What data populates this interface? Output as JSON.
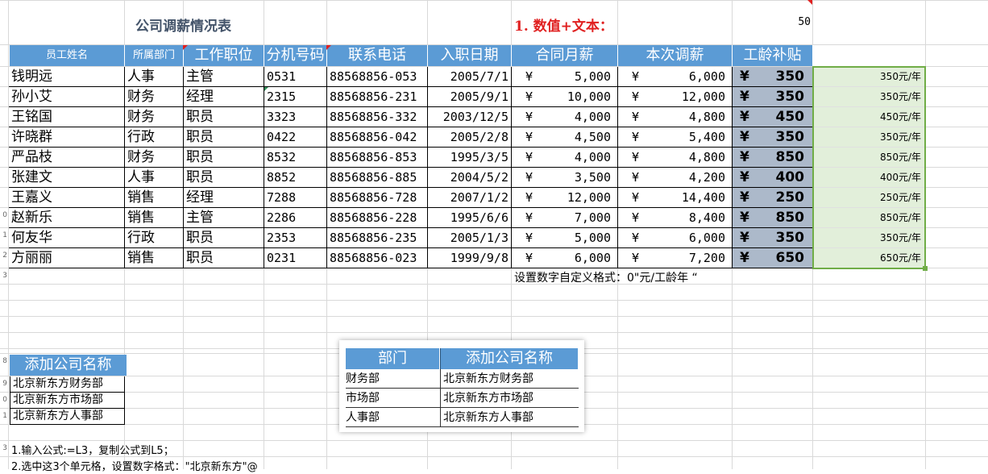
{
  "title": "公司调薪情况表",
  "example_label": "1. 数值+文本：",
  "example_value": "50",
  "headers": [
    "员工姓名",
    "所属部门",
    "工作职位",
    "分机号码",
    "联系电话",
    "入职日期",
    "合同月薪",
    "本次调薪",
    "工龄补贴"
  ],
  "rows": [
    {
      "name": "钱明远",
      "dept": "人事",
      "pos": "主管",
      "ext": "0531",
      "phone": "88568856-053",
      "date": "2005/7/1",
      "salary": "5,000",
      "raise": "6,000",
      "bonus": "350",
      "fmt": "350元/年"
    },
    {
      "name": "孙小艾",
      "dept": "财务",
      "pos": "经理",
      "ext": "2315",
      "phone": "88568856-231",
      "date": "2005/9/1",
      "salary": "10,000",
      "raise": "12,000",
      "bonus": "350",
      "fmt": "350元/年"
    },
    {
      "name": "王铭国",
      "dept": "财务",
      "pos": "职员",
      "ext": "3323",
      "phone": "88568856-332",
      "date": "2003/12/5",
      "salary": "4,000",
      "raise": "4,800",
      "bonus": "450",
      "fmt": "450元/年"
    },
    {
      "name": "许晓群",
      "dept": "行政",
      "pos": "职员",
      "ext": "0422",
      "phone": "88568856-042",
      "date": "2005/2/8",
      "salary": "4,500",
      "raise": "5,400",
      "bonus": "350",
      "fmt": "350元/年"
    },
    {
      "name": "严品枝",
      "dept": "财务",
      "pos": "职员",
      "ext": "8532",
      "phone": "88568856-853",
      "date": "1995/3/5",
      "salary": "4,000",
      "raise": "4,800",
      "bonus": "850",
      "fmt": "850元/年"
    },
    {
      "name": "张建文",
      "dept": "人事",
      "pos": "职员",
      "ext": "8852",
      "phone": "88568856-885",
      "date": "2004/5/2",
      "salary": "3,500",
      "raise": "4,200",
      "bonus": "400",
      "fmt": "400元/年"
    },
    {
      "name": "王嘉义",
      "dept": "销售",
      "pos": "经理",
      "ext": "7288",
      "phone": "88568856-728",
      "date": "2007/1/2",
      "salary": "12,000",
      "raise": "14,400",
      "bonus": "250",
      "fmt": "250元/年"
    },
    {
      "name": "赵新乐",
      "dept": "销售",
      "pos": "主管",
      "ext": "2286",
      "phone": "88568856-228",
      "date": "1995/6/6",
      "salary": "7,000",
      "raise": "8,400",
      "bonus": "850",
      "fmt": "850元/年"
    },
    {
      "name": "何友华",
      "dept": "行政",
      "pos": "职员",
      "ext": "2353",
      "phone": "88568856-235",
      "date": "2005/1/3",
      "salary": "5,000",
      "raise": "6,000",
      "bonus": "350",
      "fmt": "350元/年"
    },
    {
      "name": "方丽丽",
      "dept": "销售",
      "pos": "职员",
      "ext": "0231",
      "phone": "88568856-023",
      "date": "1999/9/8",
      "salary": "6,000",
      "raise": "7,200",
      "bonus": "650",
      "fmt": "650元/年"
    }
  ],
  "currency": "¥",
  "format_note": "设置数字自定义格式：0\"元/工龄年 “",
  "company_header": "添加公司名称",
  "company_list": [
    "北京新东方财务部",
    "北京新东方市场部",
    "北京新东方人事部"
  ],
  "popup": {
    "col1": "部门",
    "col2": "添加公司名称",
    "rows": [
      {
        "dept": "财务部",
        "name": "北京新东方财务部"
      },
      {
        "dept": "市场部",
        "name": "北京新东方市场部"
      },
      {
        "dept": "人事部",
        "name": "北京新东方人事部"
      }
    ]
  },
  "instructions": [
    "1.输入公式:=L3，复制公式到L5；",
    "2.选中这3个单元格，设置数字格式：\"北京新东方\"@"
  ],
  "row_numbers": [
    "",
    "",
    "",
    "",
    "",
    "",
    "",
    "",
    "",
    "0",
    "1",
    "2",
    "3",
    "",
    "",
    "",
    "",
    "",
    "8",
    "9",
    "0",
    "1",
    "",
    "3",
    ""
  ]
}
